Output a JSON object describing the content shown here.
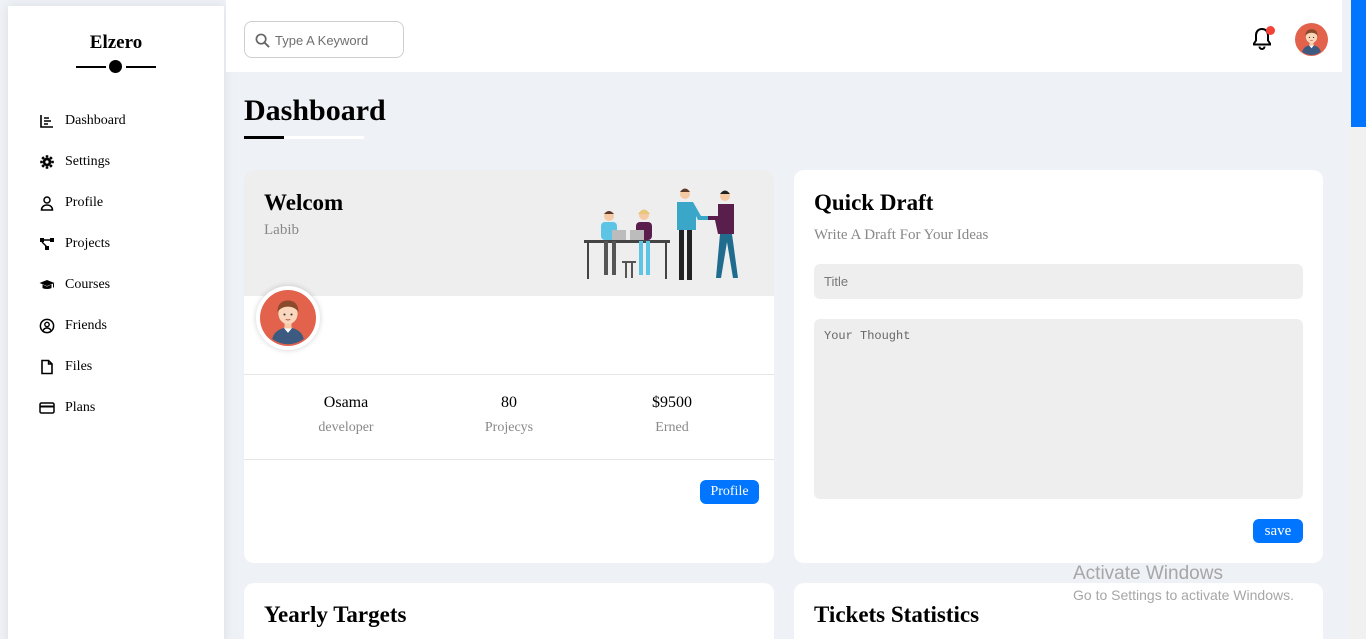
{
  "sidebar": {
    "brand": "Elzero",
    "items": [
      {
        "label": "Dashboard",
        "icon": "chart-icon"
      },
      {
        "label": "Settings",
        "icon": "gear-icon"
      },
      {
        "label": "Profile",
        "icon": "user-icon"
      },
      {
        "label": "Projects",
        "icon": "diagram-icon"
      },
      {
        "label": "Courses",
        "icon": "graduation-cap-icon"
      },
      {
        "label": "Friends",
        "icon": "user-circle-icon"
      },
      {
        "label": "Files",
        "icon": "file-icon"
      },
      {
        "label": "Plans",
        "icon": "credit-card-icon"
      }
    ]
  },
  "header": {
    "search_placeholder": "Type A Keyword",
    "notification_indicator_color": "#f44336"
  },
  "page": {
    "title": "Dashboard"
  },
  "welcome": {
    "title": "Welcom",
    "name": "Labib",
    "stats": [
      {
        "value": "Osama",
        "label": "developer"
      },
      {
        "value": "80",
        "label": "Projecys"
      },
      {
        "value": "$9500",
        "label": "Erned"
      }
    ],
    "button": "Profile"
  },
  "draft": {
    "title": "Quick Draft",
    "subtitle": "Write A Draft For Your Ideas",
    "title_placeholder": "Title",
    "body_placeholder": "Your Thought",
    "button": "save"
  },
  "sections": {
    "targets_title": "Yearly Targets",
    "tickets_title": "Tickets Statistics"
  },
  "watermark": {
    "line1": "Activate Windows",
    "line2": "Go to Settings to activate Windows."
  },
  "colors": {
    "accent": "#0075ff",
    "page_bg": "#eef1f6",
    "card_header_bg": "#eeeeee"
  }
}
